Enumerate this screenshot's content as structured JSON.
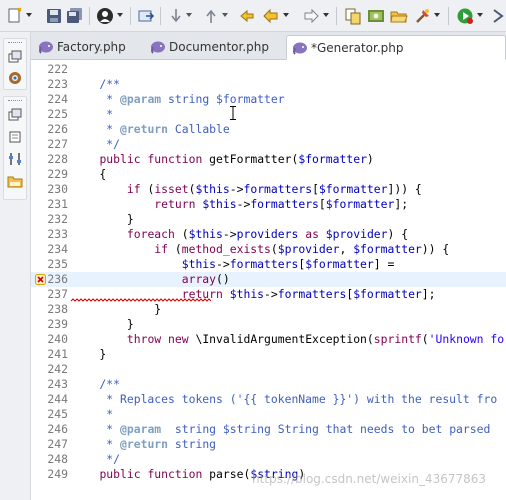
{
  "toolbar": {
    "icons": [
      "new-file-icon",
      "save-icon",
      "save-all-icon",
      "person-icon",
      "open-file-icon",
      "next-annotation-icon",
      "previous-annotation-icon",
      "last-edit-icon",
      "back-icon",
      "forward-icon",
      "copy-icon",
      "php-perspective-icon",
      "open-folder-icon",
      "external-tool-icon",
      "run-icon",
      "debug-icon"
    ],
    "colors": {
      "run": "#2e9e3b",
      "stop": "#cc2222"
    }
  },
  "sidebar": {
    "icons": [
      "restore-icon",
      "settings-gear-icon",
      "restore-icon",
      "restore-icon",
      "hierarchy-icon",
      "git-repository-icon"
    ]
  },
  "tabs": [
    {
      "label": "Factory.php",
      "active": false
    },
    {
      "label": "Documentor.php",
      "active": false
    },
    {
      "label": "*Generator.php",
      "active": true
    }
  ],
  "editor": {
    "current_line": 236,
    "error_line": 236,
    "lines": [
      {
        "n": "222",
        "t": ""
      },
      {
        "n": "223",
        "t": "    /**"
      },
      {
        "n": "224",
        "t": "     * @param string $formatter"
      },
      {
        "n": "225",
        "t": "     *"
      },
      {
        "n": "226",
        "t": "     * @return Callable"
      },
      {
        "n": "227",
        "t": "     */"
      },
      {
        "n": "228",
        "t": "    public function getFormatter($formatter)"
      },
      {
        "n": "229",
        "t": "    {"
      },
      {
        "n": "230",
        "t": "        if (isset($this->formatters[$formatter])) {"
      },
      {
        "n": "231",
        "t": "            return $this->formatters[$formatter];"
      },
      {
        "n": "232",
        "t": "        }"
      },
      {
        "n": "233",
        "t": "        foreach ($this->providers as $provider) {"
      },
      {
        "n": "234",
        "t": "            if (method_exists($provider, $formatter)) {"
      },
      {
        "n": "235",
        "t": "                $this->formatters[$formatter] ="
      },
      {
        "n": "236",
        "t": "                array($)"
      },
      {
        "n": "237",
        "t": "                return $this->formatters[$formatter];"
      },
      {
        "n": "238",
        "t": "            }"
      },
      {
        "n": "239",
        "t": "        }"
      },
      {
        "n": "240",
        "t": "        throw new \\InvalidArgumentException(sprintf('Unknown fo"
      },
      {
        "n": "241",
        "t": "    }"
      },
      {
        "n": "242",
        "t": ""
      },
      {
        "n": "243",
        "t": "    /**"
      },
      {
        "n": "244",
        "t": "     * Replaces tokens ('{{ tokenName }}') with the result fro"
      },
      {
        "n": "245",
        "t": "     *"
      },
      {
        "n": "246",
        "t": "     * @param  string $string String that needs to bet parsed"
      },
      {
        "n": "247",
        "t": "     * @return string"
      },
      {
        "n": "248",
        "t": "     */"
      },
      {
        "n": "249",
        "t": "    public function parse($string)"
      }
    ]
  },
  "watermark": "https://blog.csdn.net/weixin_43677863"
}
